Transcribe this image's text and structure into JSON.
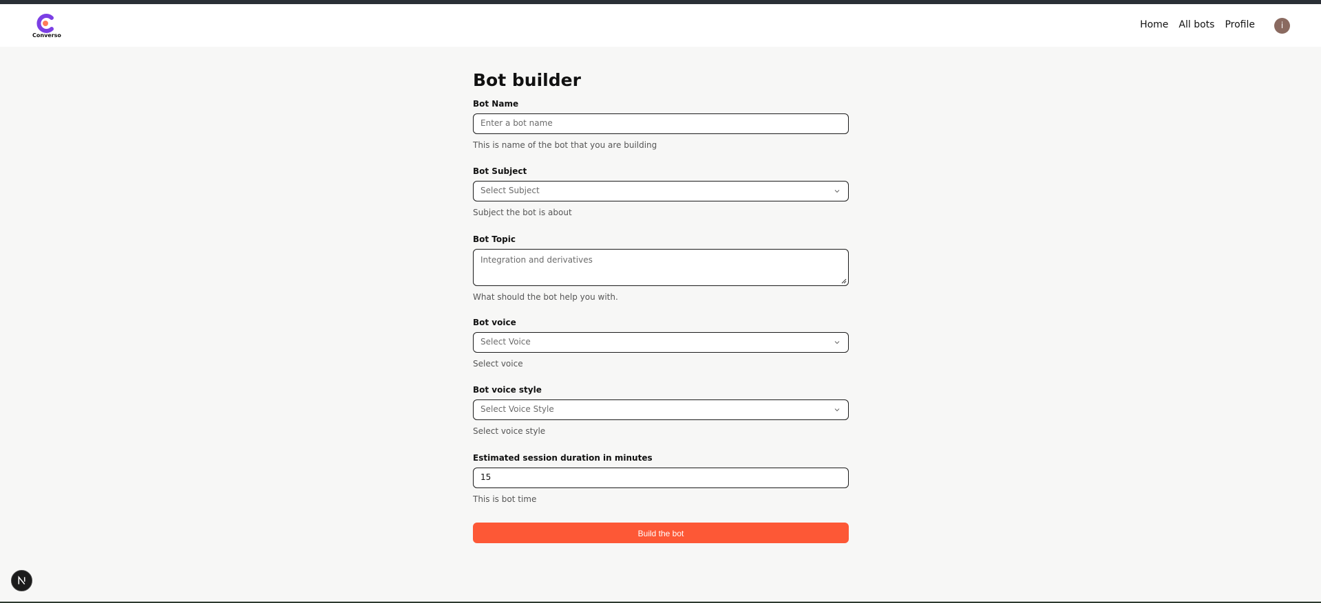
{
  "brand": {
    "name": "Converso",
    "accent": "#7b3fe4"
  },
  "nav": {
    "home": "Home",
    "all_bots": "All bots",
    "profile": "Profile"
  },
  "user": {
    "avatar_initial": "i"
  },
  "page": {
    "title": "Bot builder"
  },
  "fields": {
    "name": {
      "label": "Bot Name",
      "placeholder": "Enter a bot name",
      "hint": "This is name of the bot that you are building"
    },
    "subject": {
      "label": "Bot Subject",
      "selected": "Select Subject",
      "hint": "Subject the bot is about"
    },
    "topic": {
      "label": "Bot Topic",
      "placeholder": "Integration and derivatives",
      "hint": "What should the bot help you with."
    },
    "voice": {
      "label": "Bot voice",
      "selected": "Select Voice",
      "hint": "Select voice"
    },
    "voice_style": {
      "label": "Bot voice style",
      "selected": "Select Voice Style",
      "hint": "Select voice style"
    },
    "duration": {
      "label": "Estimated session duration in minutes",
      "value": "15",
      "hint": "This is bot time"
    }
  },
  "build_button": {
    "label": "Build the bot",
    "color": "#fd5836"
  },
  "dev_badge": {
    "letter": "N"
  }
}
